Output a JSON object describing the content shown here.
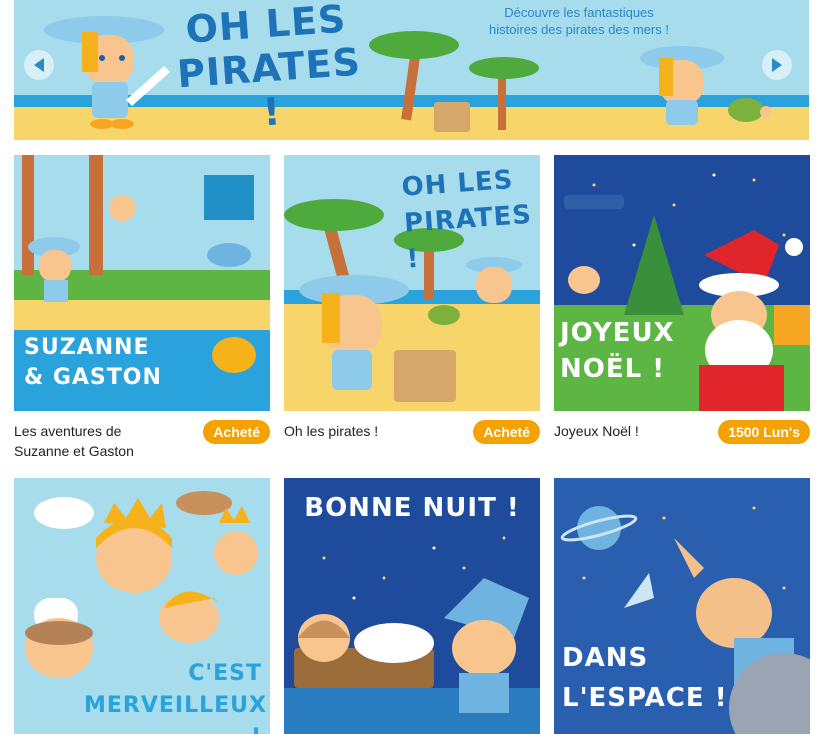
{
  "banner": {
    "title_line1": "OH LES",
    "title_line2": "PIRATES !",
    "subtitle_line1": "Découvre les fantastiques",
    "subtitle_line2": "histoires des pirates des mers !",
    "prev_icon": "chevron-left-icon",
    "next_icon": "chevron-right-icon"
  },
  "colors": {
    "accent": "#f5a200",
    "sky": "#a6dcec",
    "sea": "#2aa3dc",
    "sand": "#f7d56b",
    "night": "#1f4b9c"
  },
  "books": [
    {
      "cover_line1": "SUZANNE",
      "cover_line2": "& GASTON",
      "caption_line1": "Les aventures de",
      "caption_line2": "Suzanne et Gaston",
      "badge": "Acheté"
    },
    {
      "cover_line1": "OH LES",
      "cover_line2": "PIRATES !",
      "caption_line1": "Oh les pirates !",
      "caption_line2": "",
      "badge": "Acheté"
    },
    {
      "cover_line1": "JOYEUX",
      "cover_line2": "NOËL !",
      "caption_line1": "Joyeux Noël !",
      "caption_line2": "",
      "badge": "1500 Lun's"
    },
    {
      "cover_line1": "C'EST",
      "cover_line2": "MERVEILLEUX !"
    },
    {
      "cover_line1": "BONNE NUIT !",
      "cover_line2": ""
    },
    {
      "cover_line1": "DANS",
      "cover_line2": "L'ESPACE !"
    }
  ]
}
